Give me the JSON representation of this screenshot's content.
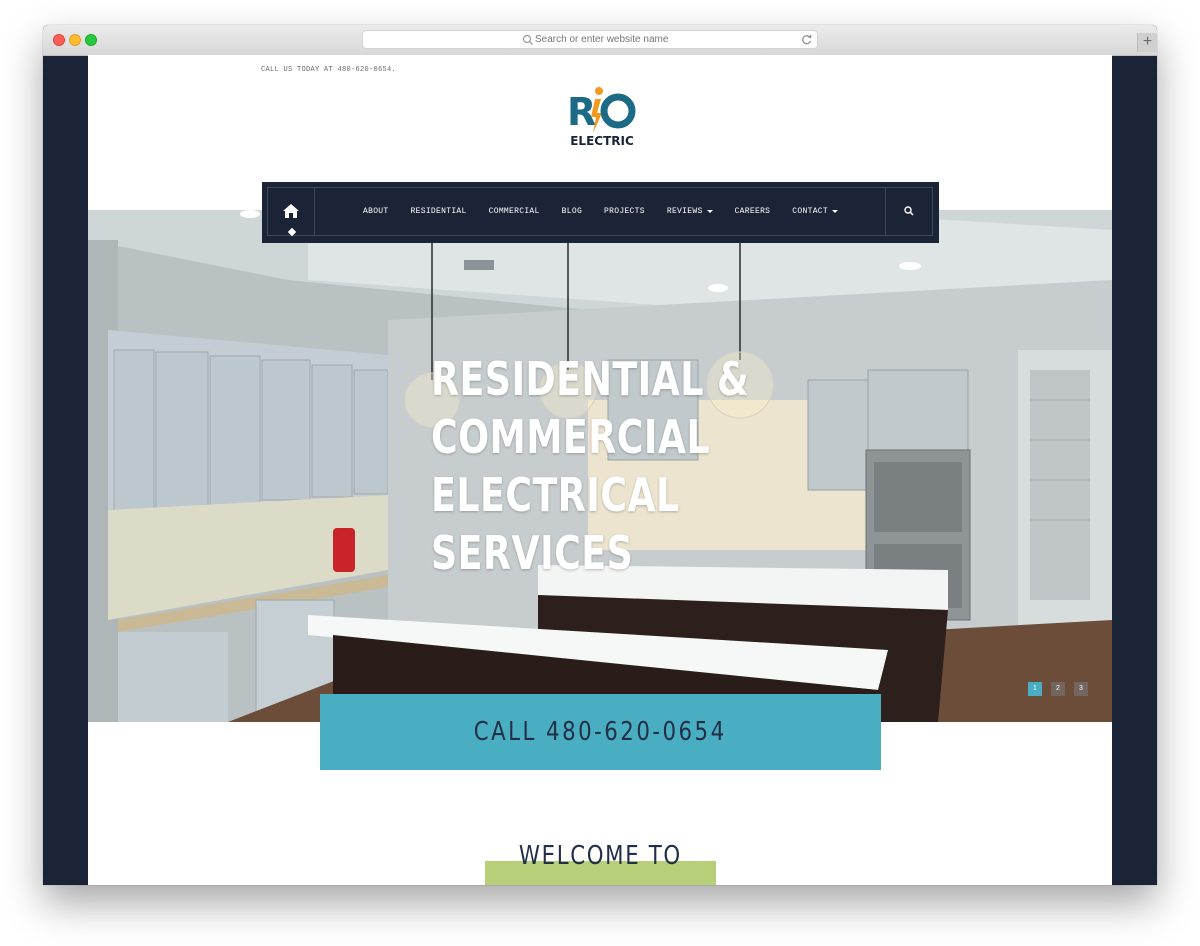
{
  "browser": {
    "url_placeholder": "Search or enter website name",
    "new_tab_label": "+"
  },
  "header": {
    "call_line": "CALL US TODAY AT 480-620-0654.",
    "logo_text_top": "RIO",
    "logo_text_bottom": "ELECTRIC",
    "logo_colors": {
      "teal": "#1d6a86",
      "orange": "#f29a1d",
      "dark": "#1b2437"
    }
  },
  "nav": {
    "home_icon": "home-icon",
    "search_icon": "search-icon",
    "items": [
      {
        "label": "ABOUT",
        "dropdown": false
      },
      {
        "label": "RESIDENTIAL",
        "dropdown": false
      },
      {
        "label": "COMMERCIAL",
        "dropdown": false
      },
      {
        "label": "BLOG",
        "dropdown": false
      },
      {
        "label": "PROJECTS",
        "dropdown": false
      },
      {
        "label": "REVIEWS",
        "dropdown": true
      },
      {
        "label": "CAREERS",
        "dropdown": false
      },
      {
        "label": "CONTACT",
        "dropdown": true
      }
    ]
  },
  "hero": {
    "title_lines": [
      "RESIDENTIAL &",
      "COMMERCIAL",
      "ELECTRICAL",
      "SERVICES"
    ],
    "slides": [
      "1",
      "2",
      "3"
    ],
    "active_slide": "1"
  },
  "cta": {
    "label": "CALL 480-620-0654",
    "color": "#4aaec2"
  },
  "welcome": {
    "heading": "WELCOME TO",
    "accent_color": "#b7cf78"
  },
  "colors": {
    "frame": "#1b2437",
    "nav_border": "#3d4b62"
  }
}
